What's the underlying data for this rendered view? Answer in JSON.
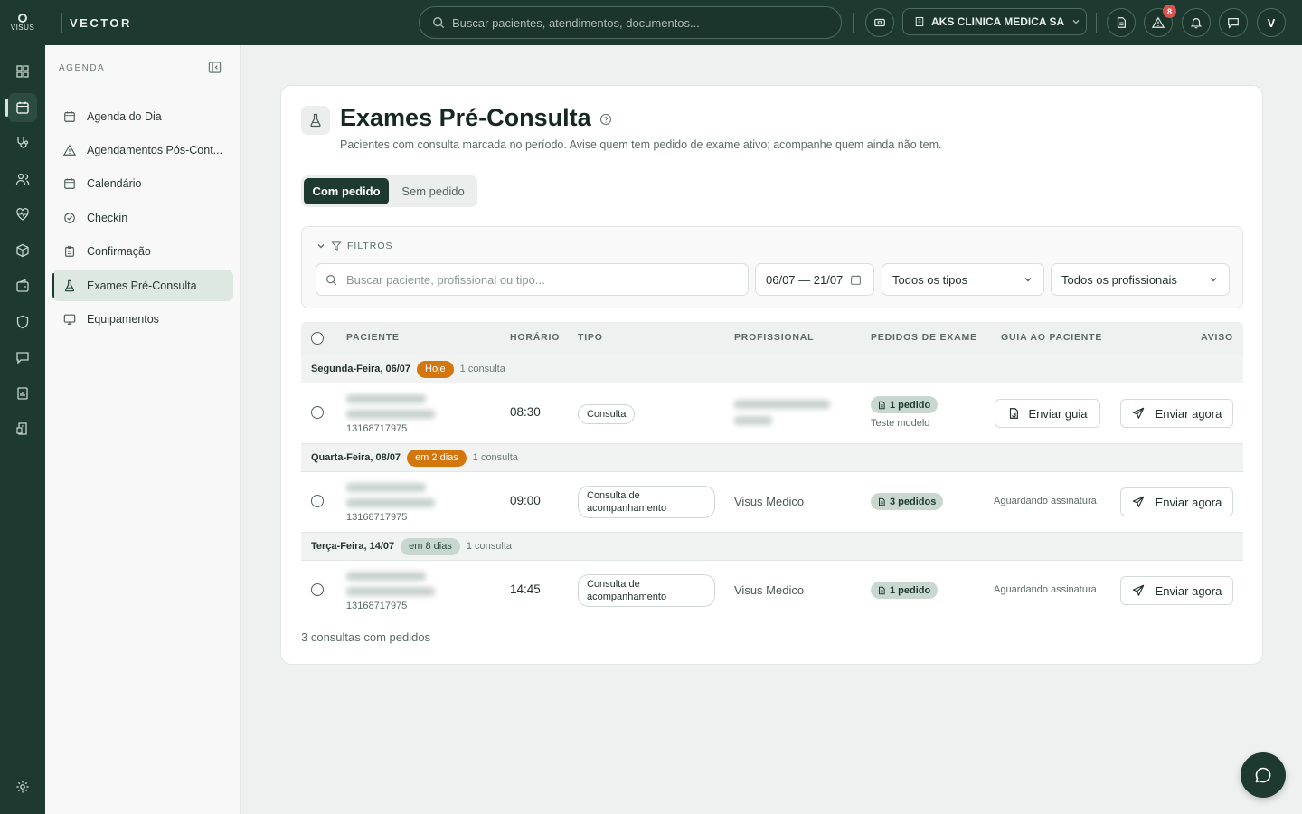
{
  "topbar": {
    "logo_text": "VISUS",
    "brand": "VECTOR",
    "search_placeholder": "Buscar pacientes, atendimentos, documentos...",
    "clinic": "AKS CLINICA MEDICA SA",
    "alerts_count": "8",
    "avatar_initial": "V"
  },
  "subnav": {
    "heading": "AGENDA",
    "items": [
      {
        "label": "Agenda do Dia",
        "icon": "calendar-icon"
      },
      {
        "label": "Agendamentos Pós-Cont...",
        "icon": "warning-icon"
      },
      {
        "label": "Calendário",
        "icon": "calendar-icon"
      },
      {
        "label": "Checkin",
        "icon": "check-circle-icon"
      },
      {
        "label": "Confirmação",
        "icon": "clipboard-icon"
      },
      {
        "label": "Exames Pré-Consulta",
        "icon": "flask-icon",
        "active": true
      },
      {
        "label": "Equipamentos",
        "icon": "monitor-icon"
      }
    ]
  },
  "page": {
    "title": "Exames Pré-Consulta",
    "subtitle": "Pacientes com consulta marcada no período. Avise quem tem pedido de exame ativo; acompanhe quem ainda não tem.",
    "tab_active": "Com pedido",
    "tab_inactive": "Sem pedido"
  },
  "filters": {
    "heading": "FILTROS",
    "search_placeholder": "Buscar paciente, profissional ou tipo...",
    "date_range": "06/07 — 21/07",
    "tipo": "Todos os tipos",
    "profissional": "Todos os profissionais"
  },
  "table": {
    "columns": [
      "PACIENTE",
      "HORÁRIO",
      "TIPO",
      "PROFISSIONAL",
      "PEDIDOS DE EXAME",
      "GUIA AO PACIENTE",
      "AVISO"
    ],
    "groups": [
      {
        "date": "Segunda-Feira, 06/07",
        "badge": "Hoje",
        "count": "1 consulta",
        "row": {
          "patient_id": "13168717975",
          "time": "08:30",
          "tipo": "Consulta",
          "pedidos": "1 pedido",
          "pedidos_sub": "Teste modelo",
          "guia": "Enviar guia",
          "aviso": "Enviar agora"
        }
      },
      {
        "date": "Quarta-Feira, 08/07",
        "badge": "em 2 dias",
        "count": "1 consulta",
        "row": {
          "patient_id": "13168717975",
          "time": "09:00",
          "tipo": "Consulta de acompanhamento",
          "profissional": "Visus Medico",
          "pedidos": "3 pedidos",
          "guia": "Aguardando assinatura",
          "aviso": "Enviar agora"
        }
      },
      {
        "date": "Terça-Feira, 14/07",
        "badge": "em 8 dias",
        "count": "1 consulta",
        "row": {
          "patient_id": "13168717975",
          "time": "14:45",
          "tipo": "Consulta de acompanhamento",
          "profissional": "Visus Medico",
          "pedidos": "1 pedido",
          "guia": "Aguardando assinatura",
          "aviso": "Enviar agora"
        }
      }
    ],
    "footer": "3 consultas com pedidos"
  },
  "colors": {
    "primary": "#1e3a30",
    "accent_orange": "#d2760d",
    "chip_green": "#c8d8d1"
  }
}
